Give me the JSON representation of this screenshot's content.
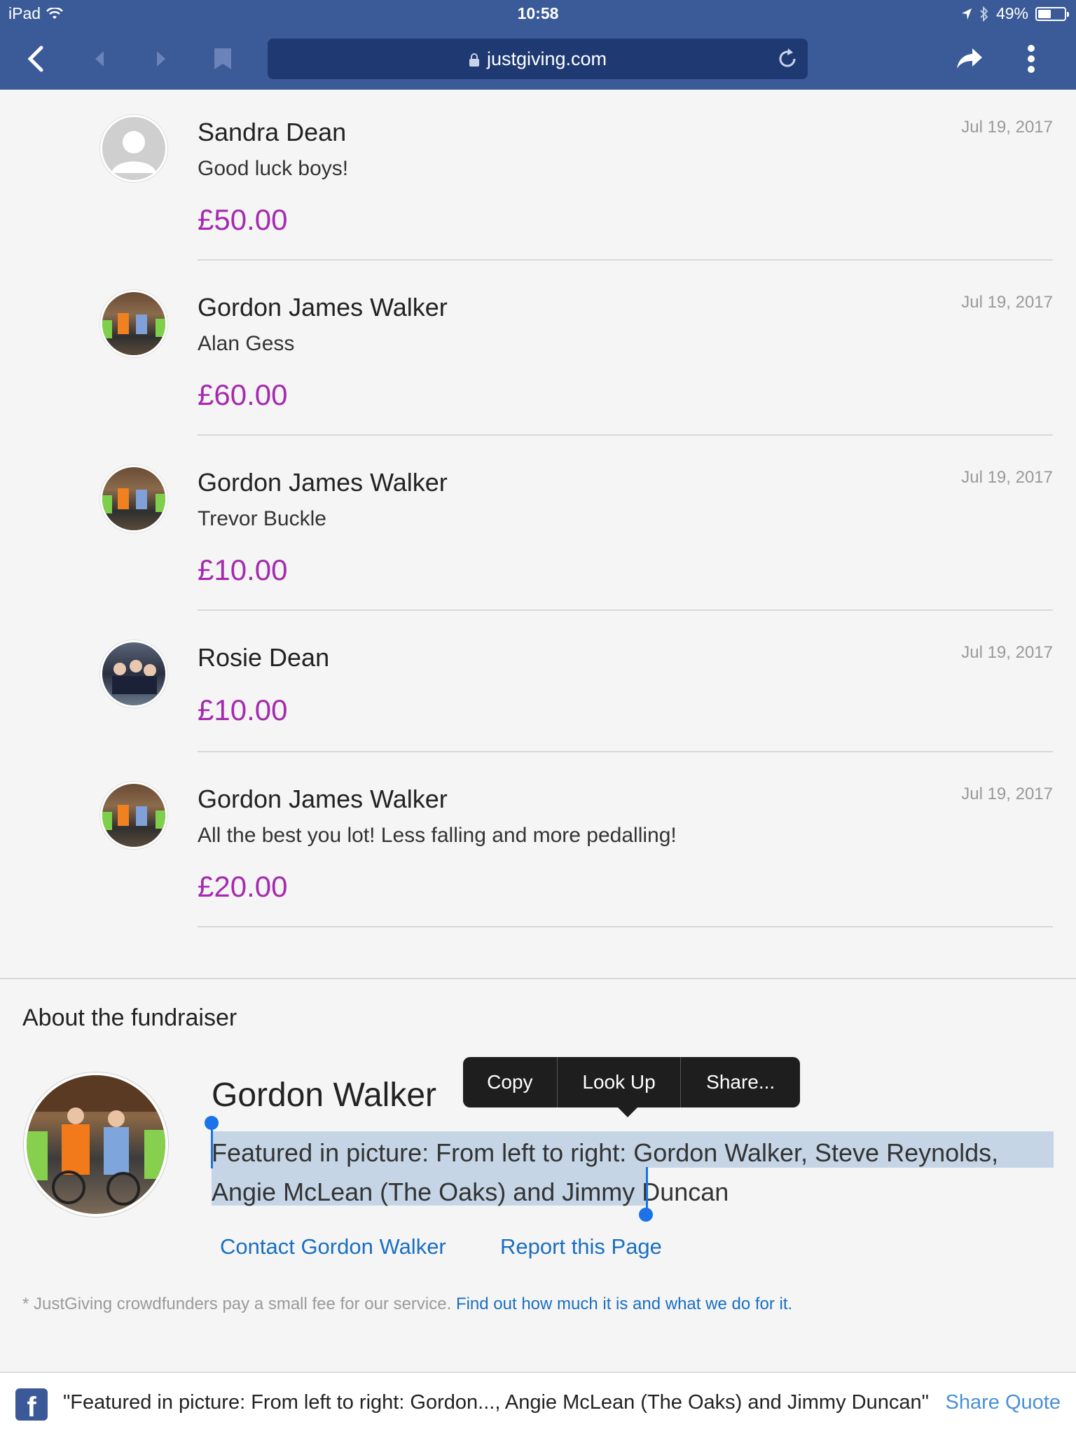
{
  "status_bar": {
    "device": "iPad",
    "time": "10:58",
    "battery": "49%",
    "battery_level": 0.49
  },
  "browser": {
    "url": "justgiving.com",
    "icons": [
      "back-icon",
      "history-back-icon",
      "history-forward-icon",
      "bookmark-icon",
      "lock-icon",
      "reload-icon",
      "share-icon",
      "more-icon"
    ]
  },
  "donations": [
    {
      "name": "Sandra Dean",
      "message": "Good luck boys!",
      "amount": "£50.00",
      "date": "Jul 19, 2017",
      "avatar": "default"
    },
    {
      "name": "Gordon James Walker",
      "message": "Alan Gess",
      "amount": "£60.00",
      "date": "Jul 19, 2017",
      "avatar": "photo"
    },
    {
      "name": "Gordon James Walker",
      "message": "Trevor Buckle",
      "amount": "£10.00",
      "date": "Jul 19, 2017",
      "avatar": "photo"
    },
    {
      "name": "Rosie Dean",
      "message": "",
      "amount": "£10.00",
      "date": "Jul 19, 2017",
      "avatar": "photo"
    },
    {
      "name": "Gordon James Walker",
      "message": "All the best you lot! Less falling and more pedalling!",
      "amount": "£20.00",
      "date": "Jul 19, 2017",
      "avatar": "photo"
    }
  ],
  "about": {
    "heading": "About the fundraiser",
    "name": "Gordon Walker",
    "description": "Featured in picture: From left to right: Gordon Walker, Steve Reynolds, Angie McLean (The Oaks) and Jimmy Duncan",
    "contact_link": "Contact Gordon Walker",
    "report_link": "Report this Page"
  },
  "context_menu": {
    "items": [
      "Copy",
      "Look Up",
      "Share..."
    ]
  },
  "fee_note": {
    "text": "* JustGiving crowdfunders pay a small fee for our service.",
    "link": "Find out how much it is and what we do for it."
  },
  "share_bar": {
    "quote": "\"Featured in picture: From left to right: Gordon..., Angie McLean (The Oaks) and Jimmy Duncan\"",
    "action": "Share Quote"
  },
  "colors": {
    "chrome": "#3a5a98",
    "amount": "#a52ab0",
    "link": "#1a6fc2",
    "selection": "#c5d5e6"
  }
}
